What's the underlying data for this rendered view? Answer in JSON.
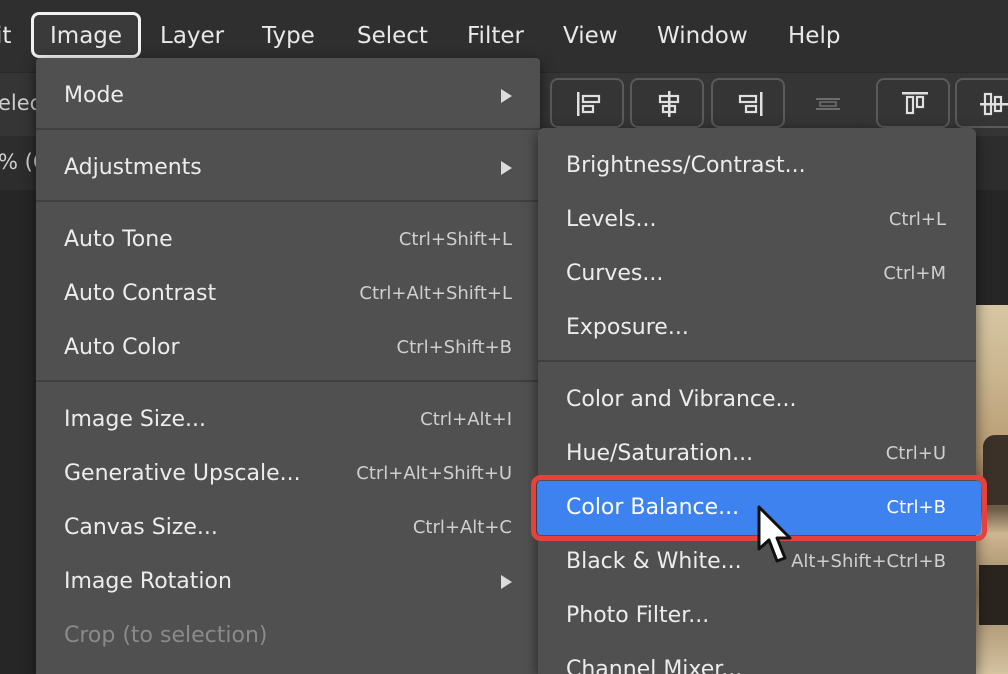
{
  "menubar": {
    "items": [
      {
        "label": "it",
        "x": -4
      },
      {
        "label": "Image",
        "active": true
      },
      {
        "label": "Layer"
      },
      {
        "label": "Type"
      },
      {
        "label": "Select"
      },
      {
        "label": "Filter"
      },
      {
        "label": "View"
      },
      {
        "label": "Window"
      },
      {
        "label": "Help"
      }
    ]
  },
  "toolbar": {
    "fragment": "elec"
  },
  "docbar": {
    "fragment": "% (C"
  },
  "image_menu": {
    "items": [
      {
        "label": "Mode",
        "submenu": true
      },
      {
        "label": "Adjustments",
        "submenu": true
      },
      {
        "label": "Auto Tone",
        "shortcut": "Ctrl+Shift+L"
      },
      {
        "label": "Auto Contrast",
        "shortcut": "Ctrl+Alt+Shift+L"
      },
      {
        "label": "Auto Color",
        "shortcut": "Ctrl+Shift+B"
      },
      {
        "label": "Image Size...",
        "shortcut": "Ctrl+Alt+I"
      },
      {
        "label": "Generative Upscale...",
        "shortcut": "Ctrl+Alt+Shift+U"
      },
      {
        "label": "Canvas Size...",
        "shortcut": "Ctrl+Alt+C"
      },
      {
        "label": "Image Rotation",
        "submenu": true
      },
      {
        "label": "Crop (to selection)",
        "disabled": true
      }
    ]
  },
  "adjustments_menu": {
    "items": [
      {
        "label": "Brightness/Contrast...",
        "shortcut": ""
      },
      {
        "label": "Levels...",
        "shortcut": "Ctrl+L"
      },
      {
        "label": "Curves...",
        "shortcut": "Ctrl+M"
      },
      {
        "label": "Exposure...",
        "shortcut": ""
      },
      {
        "label": "Color and Vibrance...",
        "shortcut": ""
      },
      {
        "label": "Hue/Saturation...",
        "shortcut": "Ctrl+U"
      },
      {
        "label": "Color Balance...",
        "shortcut": "Ctrl+B",
        "highlighted": true
      },
      {
        "label": "Black & White...",
        "shortcut": "Alt+Shift+Ctrl+B"
      },
      {
        "label": "Photo Filter...",
        "shortcut": ""
      },
      {
        "label": "Channel Mixer...",
        "shortcut": ""
      }
    ]
  },
  "colors": {
    "menubar_bg": "#2f2f2f",
    "menu_bg": "#505050",
    "highlight": "#3e82f0",
    "annotation": "#e8413c"
  }
}
